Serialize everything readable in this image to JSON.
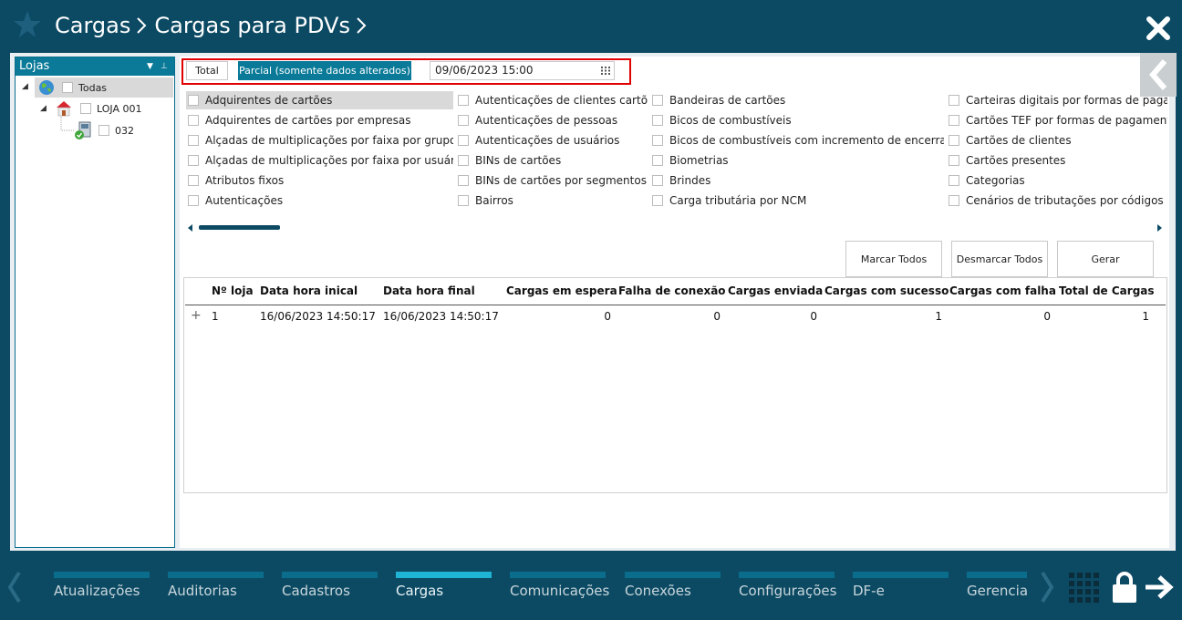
{
  "breadcrumb": {
    "level1": "Cargas",
    "level2": "Cargas para PDVs"
  },
  "left_panel": {
    "title": "Lojas",
    "tree": [
      {
        "label": "Todas"
      },
      {
        "label": "LOJA 001"
      },
      {
        "label": "032"
      }
    ]
  },
  "mode": {
    "total_label": "Total",
    "parcial_label": "Parcial (somente dados alterados)",
    "date_value": "09/06/2023 15:00"
  },
  "options": {
    "col1": [
      "Adquirentes de cartões",
      "Adquirentes de cartões por empresas",
      "Alçadas de multiplicações por faixa por grupos",
      "Alçadas de multiplicações por faixa por usuários",
      "Atributos fixos",
      "Autenticações"
    ],
    "col2": [
      "Autenticações de clientes cartões",
      "Autenticações de pessoas",
      "Autenticações de usuários",
      "BINs de cartões",
      "BINs de cartões por segmentos",
      "Bairros"
    ],
    "col3": [
      "Bandeiras de cartões",
      "Bicos de combustíveis",
      "Bicos de combustíveis com incremento de encerrante",
      "Biometrias",
      "Brindes",
      "Carga tributária por NCM"
    ],
    "col4": [
      "Carteiras digitais por formas de pagame",
      "Cartões TEF por formas de pagamentos",
      "Cartões de clientes",
      "Cartões presentes",
      "Categorias",
      "Cenários de tributações por códigos de p"
    ]
  },
  "actions": {
    "marcar": "Marcar Todos",
    "desmarcar": "Desmarcar Todos",
    "gerar": "Gerar"
  },
  "grid": {
    "headers": [
      "Nº loja",
      "Data hora inical",
      "Data hora final",
      "Cargas em espera",
      "Falha de conexão",
      "Cargas enviada",
      "Cargas com sucesso",
      "Cargas com falha",
      "Total de Cargas"
    ],
    "rows": [
      {
        "expand": "+",
        "loja": "1",
        "inicio": "16/06/2023 14:50:17",
        "fim": "16/06/2023 14:50:17",
        "espera": "0",
        "falha_conexao": "0",
        "enviada": "0",
        "sucesso": "1",
        "falha": "0",
        "total": "1"
      }
    ]
  },
  "footer": {
    "nav": [
      "Atualizações",
      "Auditorias",
      "Cadastros",
      "Cargas",
      "Comunicações",
      "Conexões",
      "Configurações",
      "DF-e",
      "Gerencia"
    ],
    "active": "Cargas"
  },
  "colors": {
    "header_bg": "#0c4a63",
    "accent": "#0a7a98",
    "active_tab": "#1fb3d5",
    "highlight_border": "#e10000"
  }
}
